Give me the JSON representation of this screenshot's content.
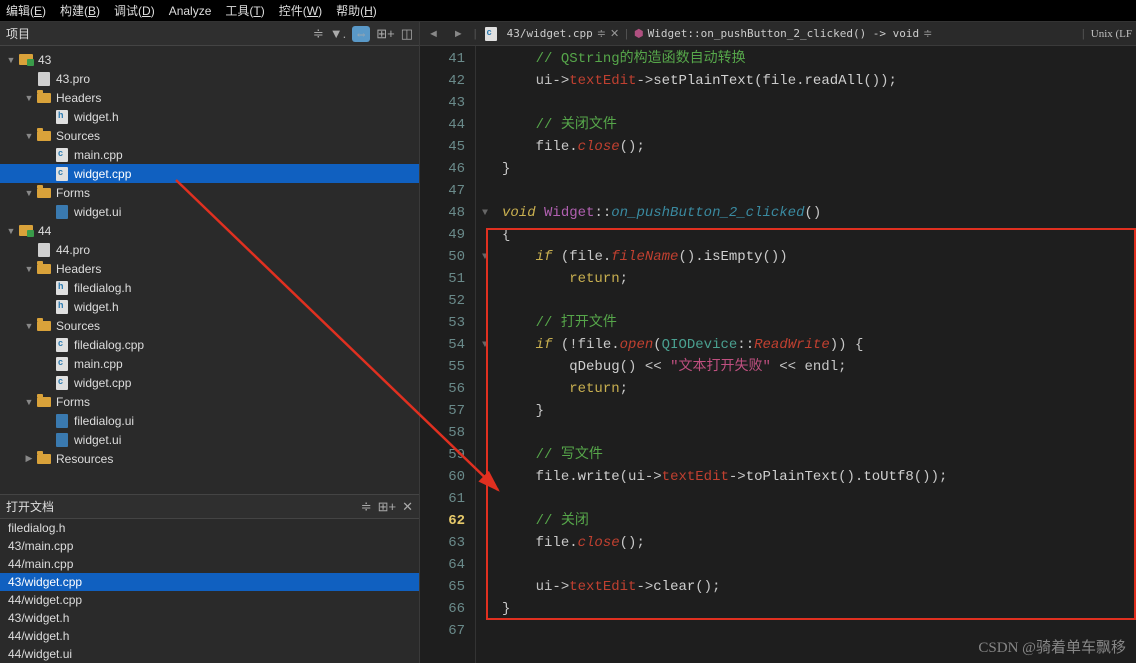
{
  "menu": [
    "编辑(E)",
    "构建(B)",
    "调试(D)",
    "Analyze",
    "工具(T)",
    "控件(W)",
    "帮助(H)"
  ],
  "project": {
    "title": "项目",
    "tree": [
      {
        "d": 1,
        "tw": "▼",
        "ico": "proj",
        "label": "43"
      },
      {
        "d": 2,
        "tw": "",
        "ico": "pro",
        "label": "43.pro"
      },
      {
        "d": 2,
        "tw": "▼",
        "ico": "folder",
        "label": "Headers"
      },
      {
        "d": 3,
        "tw": "",
        "ico": "h",
        "label": "widget.h"
      },
      {
        "d": 2,
        "tw": "▼",
        "ico": "folder",
        "label": "Sources"
      },
      {
        "d": 3,
        "tw": "",
        "ico": "c",
        "label": "main.cpp"
      },
      {
        "d": 3,
        "tw": "",
        "ico": "c",
        "label": "widget.cpp",
        "sel": true
      },
      {
        "d": 2,
        "tw": "▼",
        "ico": "folder",
        "label": "Forms"
      },
      {
        "d": 3,
        "tw": "",
        "ico": "ui",
        "label": "widget.ui"
      },
      {
        "d": 1,
        "tw": "▼",
        "ico": "proj",
        "label": "44"
      },
      {
        "d": 2,
        "tw": "",
        "ico": "pro",
        "label": "44.pro"
      },
      {
        "d": 2,
        "tw": "▼",
        "ico": "folder",
        "label": "Headers"
      },
      {
        "d": 3,
        "tw": "",
        "ico": "h",
        "label": "filedialog.h"
      },
      {
        "d": 3,
        "tw": "",
        "ico": "h",
        "label": "widget.h"
      },
      {
        "d": 2,
        "tw": "▼",
        "ico": "folder",
        "label": "Sources"
      },
      {
        "d": 3,
        "tw": "",
        "ico": "c",
        "label": "filedialog.cpp"
      },
      {
        "d": 3,
        "tw": "",
        "ico": "c",
        "label": "main.cpp"
      },
      {
        "d": 3,
        "tw": "",
        "ico": "c",
        "label": "widget.cpp"
      },
      {
        "d": 2,
        "tw": "▼",
        "ico": "folder",
        "label": "Forms"
      },
      {
        "d": 3,
        "tw": "",
        "ico": "ui",
        "label": "filedialog.ui"
      },
      {
        "d": 3,
        "tw": "",
        "ico": "ui",
        "label": "widget.ui"
      },
      {
        "d": 2,
        "tw": "▶",
        "ico": "folder",
        "label": "Resources"
      }
    ]
  },
  "openDocs": {
    "title": "打开文档",
    "items": [
      {
        "label": "filedialog.h"
      },
      {
        "label": "43/main.cpp"
      },
      {
        "label": "44/main.cpp"
      },
      {
        "label": "43/widget.cpp",
        "sel": true
      },
      {
        "label": "44/widget.cpp"
      },
      {
        "label": "43/widget.h"
      },
      {
        "label": "44/widget.h"
      },
      {
        "label": "44/widget.ui"
      }
    ]
  },
  "tabs": {
    "file": "43/widget.cpp",
    "symbol": "Widget::on_pushButton_2_clicked() -> void",
    "encoding": "Unix (LF"
  },
  "code": {
    "firstLine": 41,
    "currentLine": 62,
    "lines": [
      {
        "n": 41,
        "seg": [
          [
            "    ",
            ""
          ],
          [
            "// QString的构造函数自动转换",
            "c-cmt"
          ]
        ]
      },
      {
        "n": 42,
        "seg": [
          [
            "    ui",
            ""
          ],
          [
            "->",
            "c-op"
          ],
          [
            "textEdit",
            "c-mem"
          ],
          [
            "->",
            "c-op"
          ],
          [
            "setPlainText",
            "c-fn"
          ],
          [
            "(",
            "c-op"
          ],
          [
            "file",
            "c-txt"
          ],
          [
            ".",
            "c-op"
          ],
          [
            "readAll",
            "c-fn"
          ],
          [
            "());",
            "c-op"
          ]
        ]
      },
      {
        "n": 43,
        "seg": [
          [
            "",
            ""
          ]
        ]
      },
      {
        "n": 44,
        "seg": [
          [
            "    ",
            ""
          ],
          [
            "// 关闭文件",
            "c-cmt"
          ]
        ]
      },
      {
        "n": 45,
        "seg": [
          [
            "    ",
            ""
          ],
          [
            "file",
            "c-txt"
          ],
          [
            ".",
            "c-op"
          ],
          [
            "close",
            "c-mem-i"
          ],
          [
            "();",
            "c-op"
          ]
        ]
      },
      {
        "n": 46,
        "seg": [
          [
            "}",
            "c-op"
          ]
        ]
      },
      {
        "n": 47,
        "seg": [
          [
            "",
            ""
          ]
        ]
      },
      {
        "n": 48,
        "fold": "▼",
        "seg": [
          [
            "void ",
            "c-kw"
          ],
          [
            "Widget",
            "c-type"
          ],
          [
            "::",
            "c-op"
          ],
          [
            "on_pushButton_2_clicked",
            "c-sp"
          ],
          [
            "()",
            "c-op"
          ]
        ]
      },
      {
        "n": 49,
        "seg": [
          [
            "{",
            "c-op"
          ]
        ]
      },
      {
        "n": 50,
        "fold": "▼",
        "seg": [
          [
            "    ",
            ""
          ],
          [
            "if ",
            "c-kw"
          ],
          [
            "(",
            "c-op"
          ],
          [
            "file",
            "c-txt"
          ],
          [
            ".",
            "c-op"
          ],
          [
            "fileName",
            "c-mem-i"
          ],
          [
            "().",
            "c-op"
          ],
          [
            "isEmpty",
            "c-fn"
          ],
          [
            "())",
            "c-op"
          ]
        ]
      },
      {
        "n": 51,
        "seg": [
          [
            "        ",
            ""
          ],
          [
            "return",
            "c-kw2"
          ],
          [
            ";",
            "c-op"
          ]
        ]
      },
      {
        "n": 52,
        "seg": [
          [
            "",
            ""
          ]
        ]
      },
      {
        "n": 53,
        "seg": [
          [
            "    ",
            ""
          ],
          [
            "// 打开文件",
            "c-cmt"
          ]
        ]
      },
      {
        "n": 54,
        "fold": "▼",
        "seg": [
          [
            "    ",
            ""
          ],
          [
            "if ",
            "c-kw"
          ],
          [
            "(!",
            "c-op"
          ],
          [
            "file",
            "c-txt"
          ],
          [
            ".",
            "c-op"
          ],
          [
            "open",
            "c-mem-i"
          ],
          [
            "(",
            "c-op"
          ],
          [
            "QIODevice",
            "c-ns"
          ],
          [
            "::",
            "c-op"
          ],
          [
            "ReadWrite",
            "c-mem-i"
          ],
          [
            ")) {",
            "c-op"
          ]
        ]
      },
      {
        "n": 55,
        "seg": [
          [
            "        ",
            ""
          ],
          [
            "qDebug",
            "c-fn"
          ],
          [
            "() << ",
            "c-op"
          ],
          [
            "\"文本打开失败\"",
            "c-str"
          ],
          [
            " << ",
            "c-op"
          ],
          [
            "endl",
            "c-txt"
          ],
          [
            ";",
            "c-op"
          ]
        ]
      },
      {
        "n": 56,
        "seg": [
          [
            "        ",
            ""
          ],
          [
            "return",
            "c-kw2"
          ],
          [
            ";",
            "c-op"
          ]
        ]
      },
      {
        "n": 57,
        "seg": [
          [
            "    }",
            "c-op"
          ]
        ]
      },
      {
        "n": 58,
        "seg": [
          [
            "",
            ""
          ]
        ]
      },
      {
        "n": 59,
        "seg": [
          [
            "    ",
            ""
          ],
          [
            "// 写文件",
            "c-cmt"
          ]
        ]
      },
      {
        "n": 60,
        "seg": [
          [
            "    ",
            ""
          ],
          [
            "file",
            "c-txt"
          ],
          [
            ".",
            "c-op"
          ],
          [
            "write",
            "c-fn"
          ],
          [
            "(",
            "c-op"
          ],
          [
            "ui",
            "c-txt"
          ],
          [
            "->",
            "c-op"
          ],
          [
            "textEdit",
            "c-mem"
          ],
          [
            "->",
            "c-op"
          ],
          [
            "toPlainText",
            "c-fn"
          ],
          [
            "().",
            "c-op"
          ],
          [
            "toUtf8",
            "c-fn"
          ],
          [
            "());",
            "c-op"
          ]
        ]
      },
      {
        "n": 61,
        "seg": [
          [
            "",
            ""
          ]
        ]
      },
      {
        "n": 62,
        "seg": [
          [
            "    ",
            ""
          ],
          [
            "// 关闭",
            "c-cmt"
          ]
        ]
      },
      {
        "n": 63,
        "seg": [
          [
            "    ",
            ""
          ],
          [
            "file",
            "c-txt"
          ],
          [
            ".",
            "c-op"
          ],
          [
            "close",
            "c-mem-i"
          ],
          [
            "();",
            "c-op"
          ]
        ]
      },
      {
        "n": 64,
        "seg": [
          [
            "",
            ""
          ]
        ]
      },
      {
        "n": 65,
        "seg": [
          [
            "    ui",
            ""
          ],
          [
            "->",
            "c-op"
          ],
          [
            "textEdit",
            "c-mem"
          ],
          [
            "->",
            "c-op"
          ],
          [
            "clear",
            "c-fn"
          ],
          [
            "();",
            "c-op"
          ]
        ]
      },
      {
        "n": 66,
        "seg": [
          [
            "}",
            "c-op"
          ]
        ]
      },
      {
        "n": 67,
        "seg": [
          [
            "",
            ""
          ]
        ]
      }
    ]
  },
  "watermark": "CSDN @骑着单车飘移"
}
